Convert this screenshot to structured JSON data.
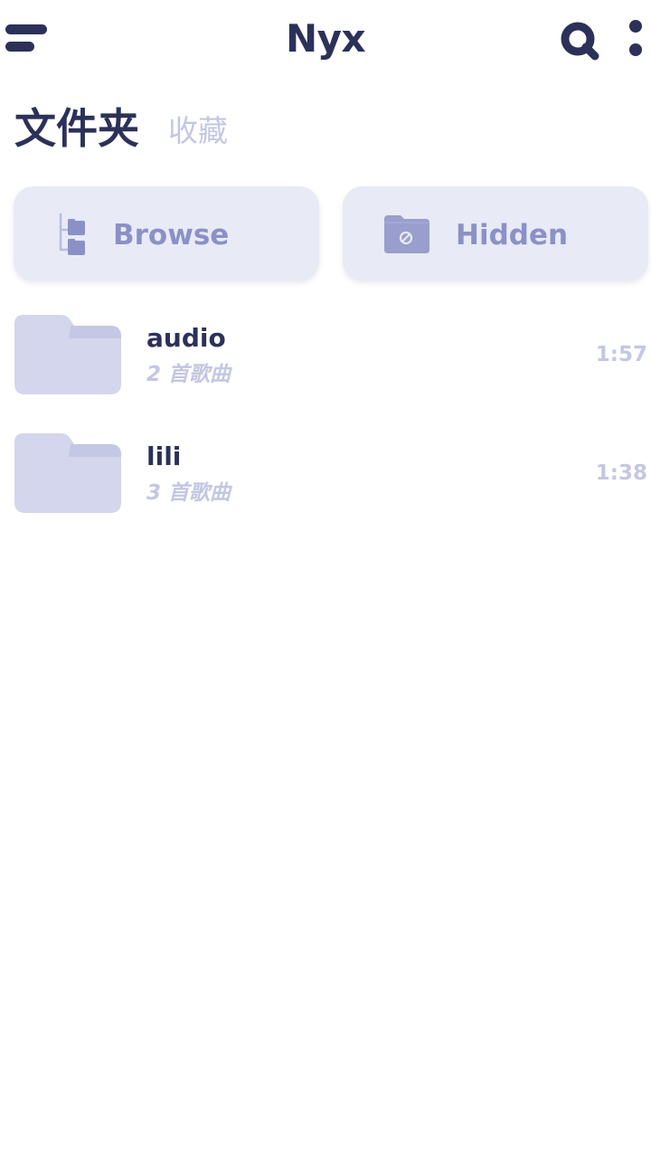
{
  "app": {
    "title": "Nyx"
  },
  "header": {
    "menu_icon": "menu-icon",
    "search_icon": "search-icon",
    "more_icon": "more-vertical-icon"
  },
  "tabs": {
    "folders": "文件夹",
    "favorites": "收藏"
  },
  "actions": [
    {
      "label": "Browse",
      "icon": "folder-tree-icon"
    },
    {
      "label": "Hidden",
      "icon": "hidden-folder-icon"
    }
  ],
  "folders": [
    {
      "name": "audio",
      "count": "2 首歌曲",
      "duration": "1:57",
      "icon": "folder-icon"
    },
    {
      "name": "lili",
      "count": "3 首歌曲",
      "duration": "1:38",
      "icon": "folder-icon"
    }
  ],
  "colors": {
    "primary_text": "#2c3159",
    "muted_text": "#c3c7e2",
    "accent": "#8b91c6",
    "card_background": "#e8eaf5",
    "folder_fill": "#d3d6ec"
  }
}
